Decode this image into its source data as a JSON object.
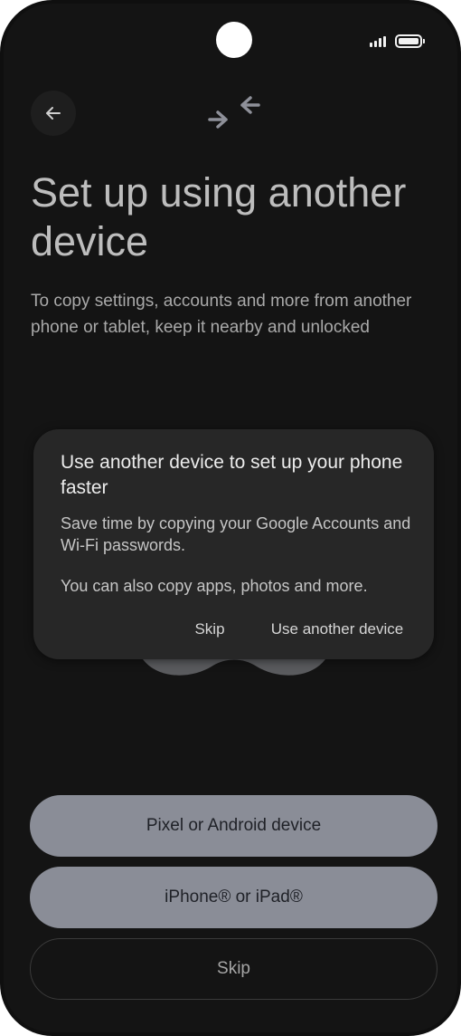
{
  "status_bar": {
    "signal_icon": "signal-bars-icon",
    "battery_icon": "battery-icon"
  },
  "header": {
    "back_icon": "arrow-left-icon",
    "hero_icon": "transfer-arrows-icon"
  },
  "page": {
    "title": "Set up using another device",
    "description": "To copy settings, accounts and more from another phone or tablet, keep it nearby and unlocked"
  },
  "dialog": {
    "title": "Use another device to set up your phone faster",
    "body_1": "Save time by copying your Google Accounts and Wi-Fi passwords.",
    "body_2": "You can also copy apps, photos and more.",
    "skip_label": "Skip",
    "use_label": "Use another device"
  },
  "buttons": {
    "pixel_label": "Pixel or Android device",
    "iphone_label": "iPhone® or iPad®",
    "skip_label": "Skip"
  },
  "colors": {
    "background": "#141414",
    "dialog": "#272727",
    "filled_button": "#8a8d97",
    "title_text": "#bdbdbd"
  }
}
